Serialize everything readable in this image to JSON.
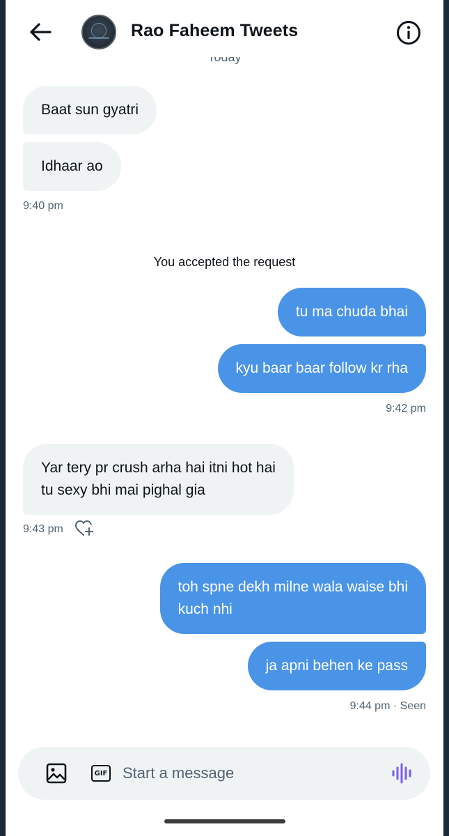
{
  "header": {
    "title": "Rao Faheem Tweets",
    "back_icon": "arrow-left-icon",
    "info_icon": "info-circle-icon",
    "divider_label": "Today"
  },
  "messages": [
    {
      "side": "in",
      "text": "Baat sun gyatri"
    },
    {
      "side": "in",
      "text": "Idhaar ao"
    },
    {
      "type": "timestamp",
      "text": "9:40 pm"
    },
    {
      "type": "system",
      "text": "You accepted the request"
    },
    {
      "side": "out",
      "text": "tu ma chuda bhai"
    },
    {
      "side": "out",
      "text": "kyu baar baar follow kr rha"
    },
    {
      "type": "timestamp",
      "text": "9:42 pm"
    },
    {
      "side": "in",
      "lines": [
        "Yar tery pr crush arha hai itni hot hai",
        "tu sexy bhi mai pighal gia"
      ]
    },
    {
      "type": "timestamp",
      "text": "9:43 pm",
      "reaction_icon": "heart-plus-icon"
    },
    {
      "side": "out",
      "lines": [
        "toh spne dekh milne wala waise bhi",
        "kuch nhi"
      ]
    },
    {
      "side": "out",
      "text": "ja apni behen ke pass"
    },
    {
      "type": "timestamp",
      "text": "9:44 pm · Seen"
    }
  ],
  "composer": {
    "placeholder": "Start a message",
    "image_icon": "image-icon",
    "gif_label": "GIF",
    "voice_icon": "voice-wave-icon"
  },
  "colors": {
    "outgoing_bubble": "#4a94e8",
    "incoming_bubble": "#eff3f4",
    "voice_accent": "#7b5cf0"
  }
}
